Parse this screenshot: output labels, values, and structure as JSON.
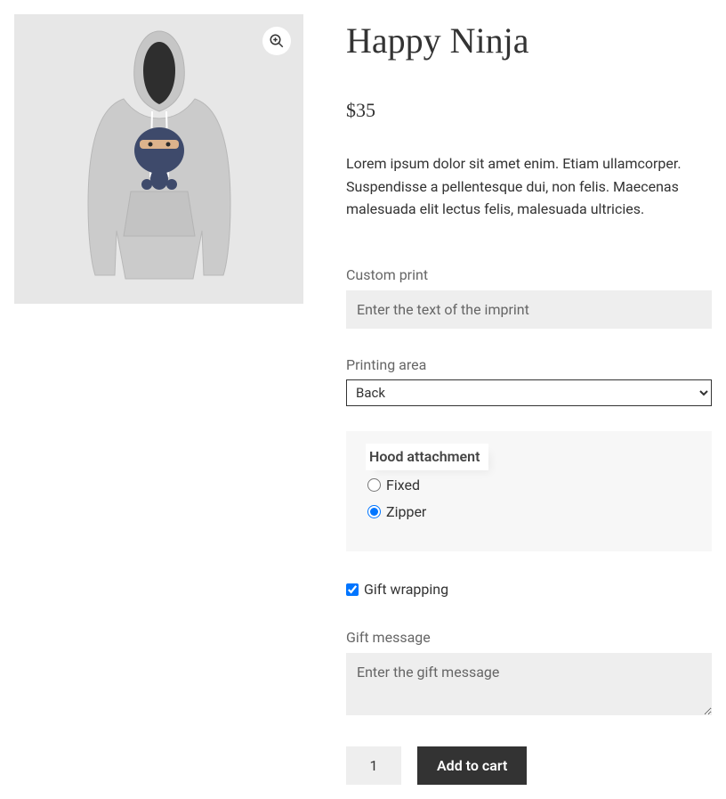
{
  "product": {
    "title": "Happy Ninja",
    "price": "$35",
    "short_description": "Lorem ipsum dolor sit amet enim. Etiam ullamcorper. Suspendisse a pellentesque dui, non felis. Maecenas malesuada elit lectus felis, malesuada ultricies."
  },
  "custom_print": {
    "label": "Custom print",
    "placeholder": "Enter the text of the imprint",
    "value": ""
  },
  "printing_area": {
    "label": "Printing area",
    "selected": "Back"
  },
  "hood_attachment": {
    "legend": "Hood attachment",
    "options": {
      "fixed": "Fixed",
      "zipper": "Zipper"
    },
    "selected": "zipper"
  },
  "gift_wrapping": {
    "label": "Gift wrapping",
    "checked": true
  },
  "gift_message": {
    "label": "Gift message",
    "placeholder": "Enter the gift message",
    "value": ""
  },
  "cart": {
    "quantity": "1",
    "button": "Add to cart"
  }
}
